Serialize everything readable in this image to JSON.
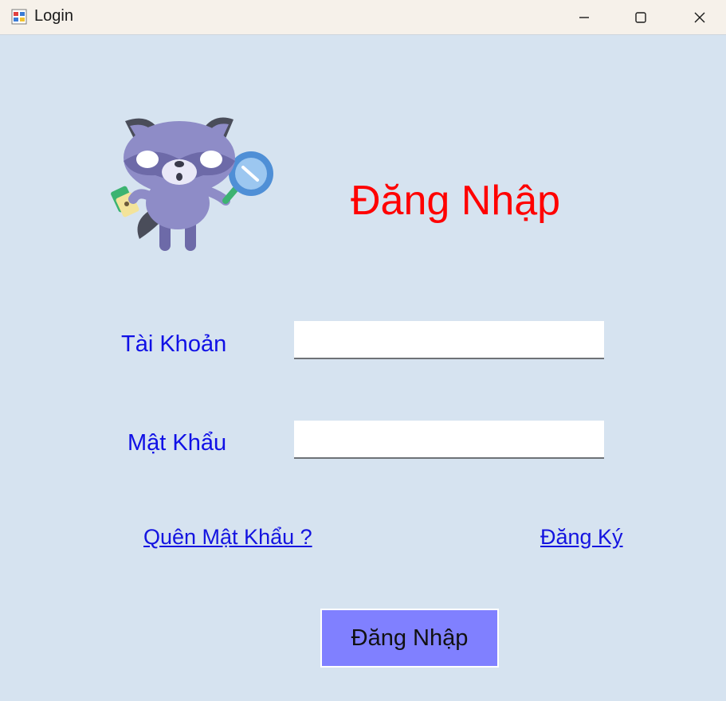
{
  "window": {
    "title": "Login",
    "app_icon": "winforms-app-icon",
    "controls": [
      "minimize-icon",
      "maximize-icon",
      "close-icon"
    ]
  },
  "form": {
    "heading": "Đăng Nhập",
    "mascot": "raccoon-with-magnifier-illustration",
    "username_label": "Tài Khoản",
    "username_value": "",
    "password_label": "Mật Khẩu",
    "password_value": "",
    "forgot_password_link": "Quên Mật Khẩu ?",
    "register_link": "Đăng Ký",
    "login_button": "Đăng Nhập"
  },
  "colors": {
    "background": "#d6e3f0",
    "titlebar": "#f6f1ea",
    "heading": "#ff0000",
    "labels": "#1010e6",
    "links": "#1414e0",
    "login_button": "#8080ff"
  }
}
